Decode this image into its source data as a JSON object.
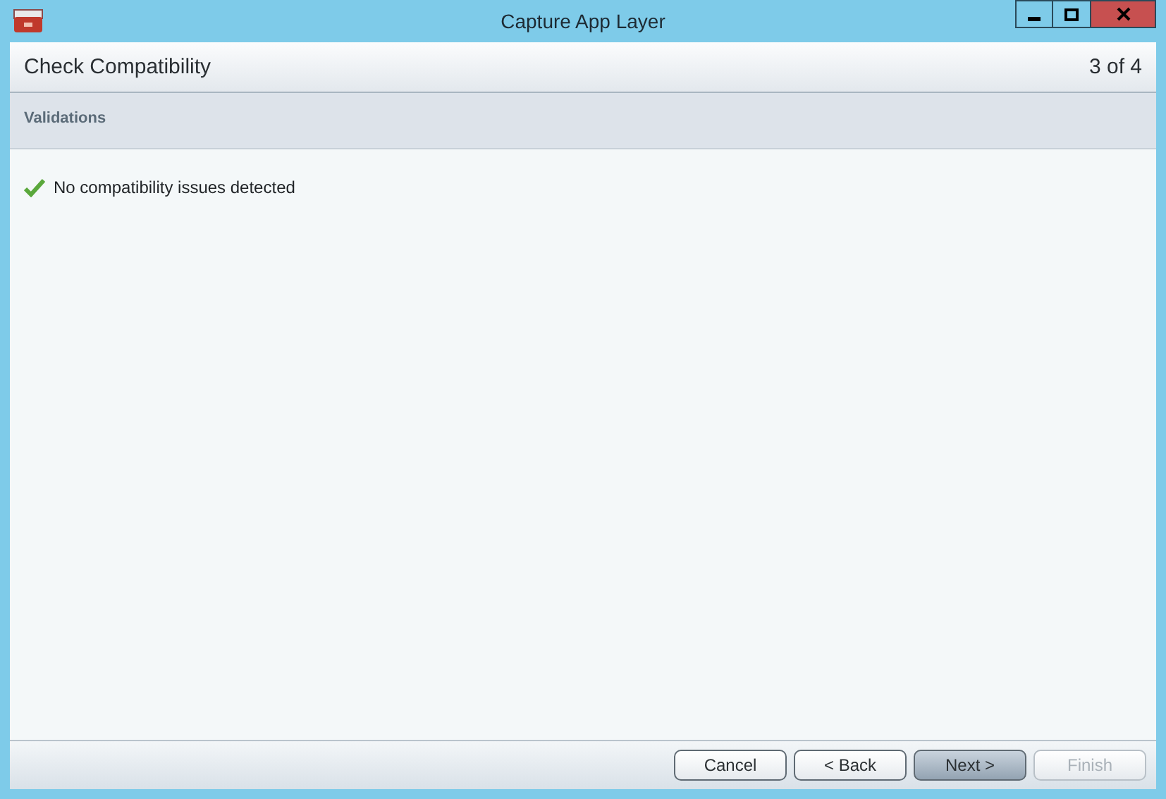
{
  "window": {
    "title": "Capture App Layer"
  },
  "header": {
    "title": "Check Compatibility",
    "step": "3 of 4"
  },
  "section": {
    "title": "Validations"
  },
  "results": [
    {
      "text": "No compatibility issues detected",
      "passed": true
    }
  ],
  "buttons": [
    {
      "label": "Cancel",
      "kind": "normal",
      "disabled": false
    },
    {
      "label": "< Back",
      "kind": "normal",
      "disabled": false
    },
    {
      "label": "Next >",
      "kind": "primary",
      "disabled": false
    },
    {
      "label": "Finish",
      "kind": "normal",
      "disabled": true
    }
  ]
}
